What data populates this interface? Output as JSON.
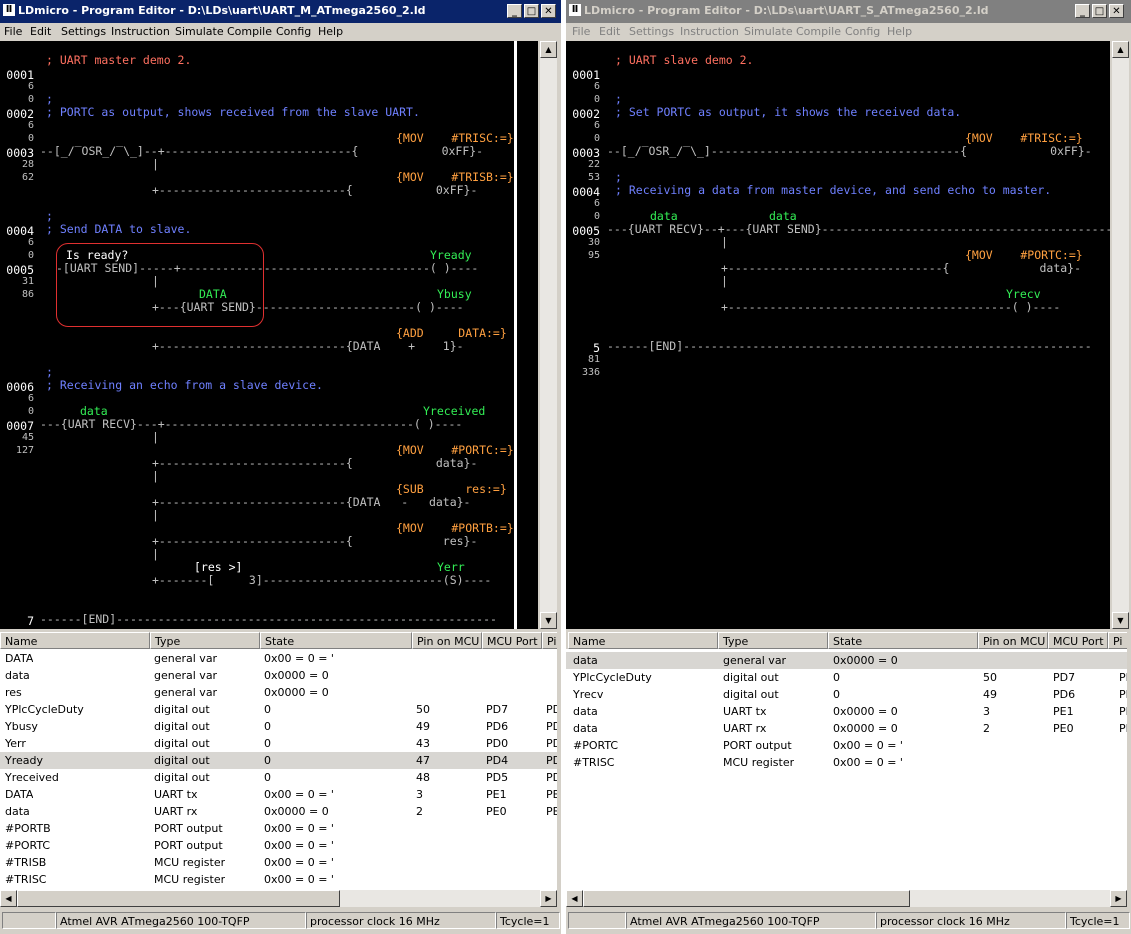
{
  "left": {
    "title": "LDmicro - Program Editor - D:\\LDs\\uart\\UART_M_ATmega2560_2.ld",
    "menu": [
      "File",
      "Edit",
      "Settings",
      "Instruction",
      "Simulate",
      "Compile",
      "Config",
      "Help"
    ],
    "rungs": [
      {
        "num": "0001",
        "sub": [
          "6",
          "0"
        ]
      },
      {
        "num": "0002",
        "sub": [
          "6",
          "0"
        ]
      },
      {
        "num": "0003",
        "sub": [
          "28",
          "62"
        ]
      },
      {
        "num": "0004",
        "sub": [
          "6",
          "0"
        ]
      },
      {
        "num": "0005",
        "sub": [
          "31",
          "86"
        ]
      },
      {
        "num": "0006",
        "sub": [
          "6",
          "0"
        ]
      },
      {
        "num": "0007",
        "sub": [
          "45",
          "127"
        ]
      },
      {
        "num": "7",
        "sub": []
      }
    ],
    "ladder": {
      "c1": "; UART master demo 2.",
      "c2a": ";",
      "c2b": "; PORTC as output, shows received from the slave UART.",
      "r3a": "{MOV    #TRISC:=}",
      "r3b": "--[_/‾OSR_/‾\\_]--+---------------------------{            0xFF}-",
      "r3c": "{MOV    #TRISB:=}",
      "r3d": "+---------------------------{            0xFF}-",
      "c4a": ";",
      "c4b": "; Send DATA to slave.",
      "r5label": "Is ready?",
      "r5coil": "Yready",
      "r5a": "-[UART SEND]-----+------------------------------------( )----",
      "r5data": "DATA",
      "r5busy": "Ybusy",
      "r5b": "+---{UART SEND}-----------------------( )----",
      "r5c": "{ADD     DATA:=}",
      "r5d": "+---------------------------{DATA    +    1}-",
      "c6a": ";",
      "c6b": "; Receiving an echo from a slave device.",
      "r7data": "data",
      "r7coil": "Yreceived",
      "r7a": "---{UART RECV}---+------------------------------------( )----",
      "r7b": "{MOV    #PORTC:=}",
      "r7c": "+---------------------------{            data}-",
      "r7d": "{SUB      res:=}",
      "r7e": "+---------------------------{DATA   -   data}-",
      "r7f": "{MOV    #PORTB:=}",
      "r7g": "+---------------------------{             res}-",
      "r7h": "[res >]",
      "r7err": "Yerr",
      "r7i": "+-------[     3]--------------------------(S)----",
      "end": "------[END]-------------------------------------------------------"
    },
    "columns": [
      "Name",
      "Type",
      "State",
      "Pin on MCU",
      "MCU Port",
      "Pi"
    ],
    "rows": [
      [
        "DATA",
        "general var",
        "0x00 = 0 = '",
        "",
        "",
        ""
      ],
      [
        "data",
        "general var",
        "0x0000 = 0",
        "",
        "",
        ""
      ],
      [
        "res",
        "general var",
        "0x0000 = 0",
        "",
        "",
        ""
      ],
      [
        "YPlcCycleDuty",
        "digital out",
        "0",
        "50",
        "PD7",
        "PD"
      ],
      [
        "Ybusy",
        "digital out",
        "0",
        "49",
        "PD6",
        "PD"
      ],
      [
        "Yerr",
        "digital out",
        "0",
        "43",
        "PD0",
        "PD"
      ],
      [
        "Yready",
        "digital out",
        "0",
        "47",
        "PD4",
        "PD"
      ],
      [
        "Yreceived",
        "digital out",
        "0",
        "48",
        "PD5",
        "PD"
      ],
      [
        "DATA",
        "UART tx",
        "0x00 = 0 = '",
        "3",
        "PE1",
        "PE"
      ],
      [
        "data",
        "UART rx",
        "0x0000 = 0",
        "2",
        "PE0",
        "PE"
      ],
      [
        "#PORTB",
        "PORT output",
        "0x00 = 0 = '",
        "",
        "",
        ""
      ],
      [
        "#PORTC",
        "PORT output",
        "0x00 = 0 = '",
        "",
        "",
        ""
      ],
      [
        "#TRISB",
        "MCU register",
        "0x00 = 0 = '",
        "",
        "",
        ""
      ],
      [
        "#TRISC",
        "MCU register",
        "0x00 = 0 = '",
        "",
        "",
        ""
      ]
    ],
    "status": [
      "Atmel AVR ATmega2560 100-TQFP",
      "processor clock 16 MHz",
      "Tcycle=1"
    ]
  },
  "right": {
    "title": "LDmicro - Program Editor - D:\\LDs\\uart\\UART_S_ATmega2560_2.ld",
    "menu": [
      "File",
      "Edit",
      "Settings",
      "Instruction",
      "Simulate",
      "Compile",
      "Config",
      "Help"
    ],
    "rungs": [
      {
        "num": "0001",
        "sub": [
          "6",
          "0"
        ]
      },
      {
        "num": "0002",
        "sub": [
          "6",
          "0"
        ]
      },
      {
        "num": "0003",
        "sub": [
          "22",
          "53"
        ]
      },
      {
        "num": "0004",
        "sub": [
          "6",
          "0"
        ]
      },
      {
        "num": "0005",
        "sub": [
          "30",
          "95"
        ]
      },
      {
        "num": "5",
        "sub": [
          "81",
          "336"
        ]
      }
    ],
    "ladder": {
      "c1": "; UART slave demo 2.",
      "c2a": ";",
      "c2b": "; Set PORTC as output, it shows the received data.",
      "r3a": "{MOV    #TRISC:=}",
      "r3b": "--[_/‾OSR_/‾\\_]------------------------------------{            0xFF}-",
      "c4a": ";",
      "c4b": "; Receiving a data from master device, and send echo to master.",
      "r5data1": "data",
      "r5data2": "data",
      "r5a": "---{UART RECV}--+---{UART SEND}------------------------------------------",
      "r5b": "{MOV    #PORTC:=}",
      "r5c": "+-------------------------------{             data}-",
      "r5coil": "Yrecv",
      "r5d": "+-----------------------------------------( )----",
      "end": "------[END]-----------------------------------------------------------"
    },
    "columns": [
      "Name",
      "Type",
      "State",
      "Pin on MCU",
      "MCU Port",
      "Pi"
    ],
    "rows": [
      [
        "data",
        "general var",
        "0x0000 = 0",
        "",
        "",
        ""
      ],
      [
        "YPlcCycleDuty",
        "digital out",
        "0",
        "50",
        "PD7",
        "PD"
      ],
      [
        "Yrecv",
        "digital out",
        "0",
        "49",
        "PD6",
        "PD"
      ],
      [
        "data",
        "UART tx",
        "0x0000 = 0",
        "3",
        "PE1",
        "PE"
      ],
      [
        "data",
        "UART rx",
        "0x0000 = 0",
        "2",
        "PE0",
        "PE"
      ],
      [
        "#PORTC",
        "PORT output",
        "0x00 = 0 = '",
        "",
        "",
        ""
      ],
      [
        "#TRISC",
        "MCU register",
        "0x00 = 0 = '",
        "",
        "",
        ""
      ]
    ],
    "status": [
      "Atmel AVR ATmega2560 100-TQFP",
      "processor clock 16 MHz",
      "Tcycle=1"
    ]
  },
  "icons": {
    "minimize": "minimize-icon",
    "maximize": "maximize-icon",
    "close": "close-icon"
  },
  "colors": {
    "title_active": "#0a246a",
    "title_inactive": "#808080",
    "comment_salmon": "#ff7060",
    "comment_blue": "#6f80ff",
    "coil_green": "#33ee55",
    "op_orange": "#ffa040",
    "highlight": "#e03030"
  }
}
